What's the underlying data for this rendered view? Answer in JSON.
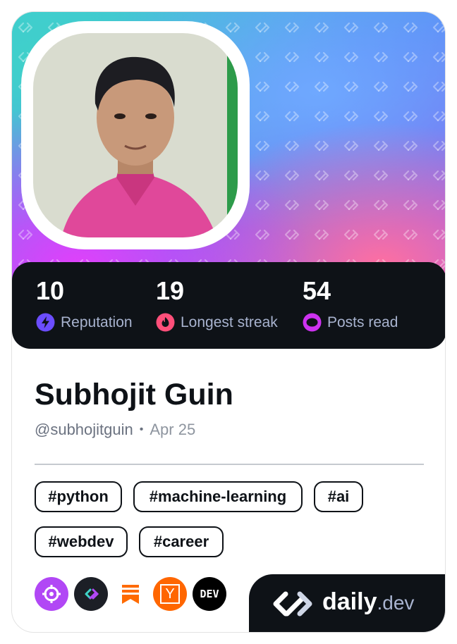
{
  "profile": {
    "name": "Subhojit Guin",
    "handle": "@subhojitguin",
    "separator": "•",
    "date": "Apr 25"
  },
  "stats": [
    {
      "value": "10",
      "label": "Reputation",
      "icon": "reputation-bolt-icon",
      "color": "#6b4dff"
    },
    {
      "value": "19",
      "label": "Longest streak",
      "icon": "streak-flame-icon",
      "color": "#ff4f7a"
    },
    {
      "value": "54",
      "label": "Posts read",
      "icon": "posts-read-eye-icon",
      "color": "#cd32f0"
    }
  ],
  "tags": [
    "#python",
    "#machine-learning",
    "#ai",
    "#webdev",
    "#career"
  ],
  "sources": [
    {
      "icon": "target-squad-icon",
      "color": "#b147f5"
    },
    {
      "icon": "daily-squad-icon",
      "color": "#1c1f26"
    },
    {
      "icon": "bookmark-source-icon",
      "color": "#ff6a00"
    },
    {
      "icon": "hacker-news-y-icon",
      "color": "#ff6600"
    },
    {
      "icon": "dev-to-icon",
      "color": "#000000",
      "text": "DEV"
    }
  ],
  "brand": {
    "name": "daily",
    "suffix": ".dev"
  },
  "hn_letter": "Y"
}
